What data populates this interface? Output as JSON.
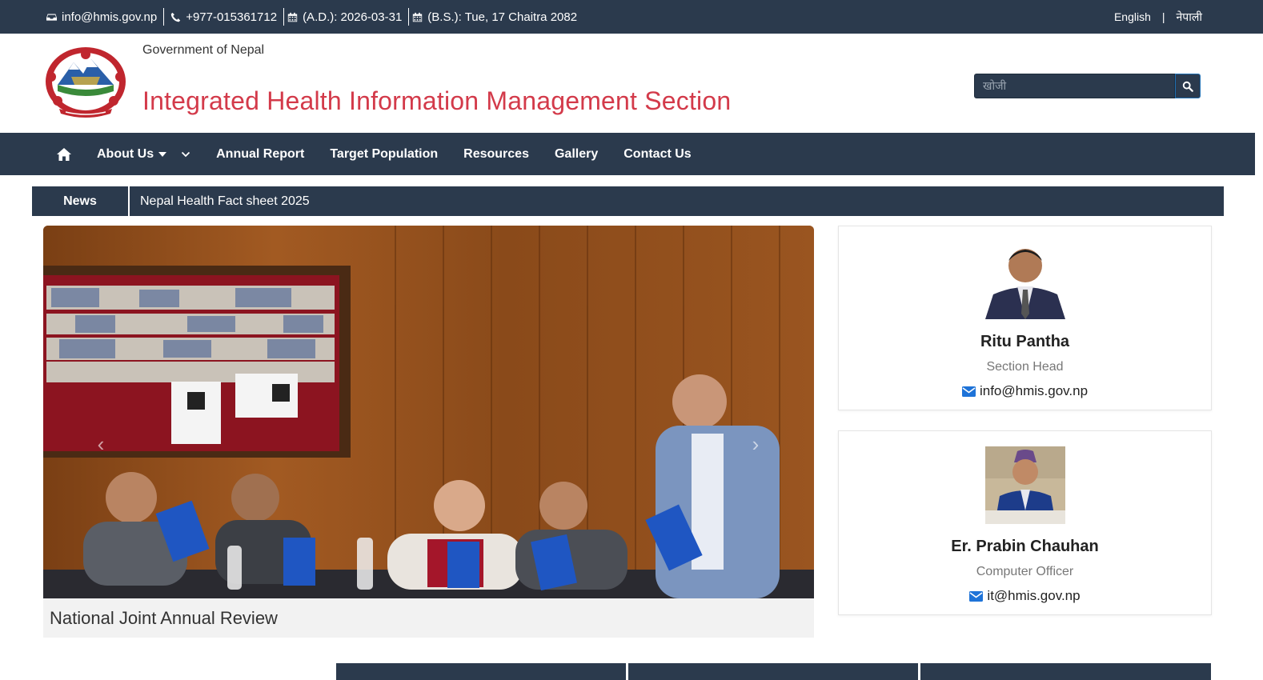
{
  "topbar": {
    "email": "info@hmis.gov.np",
    "phone": "+977-015361712",
    "date_ad": "(A.D.): 2026-03-31",
    "date_bs": "(B.S.): Tue, 17 Chaitra 2082",
    "lang_english": "English",
    "lang_separator": "|",
    "lang_nepali": "नेपाली"
  },
  "header": {
    "government": "Government of Nepal",
    "title": "Integrated Health Information Management Section",
    "search_placeholder": "खोजी"
  },
  "nav": {
    "items": [
      {
        "label": "About Us",
        "dropdown": true
      },
      {
        "label": "Annual Report"
      },
      {
        "label": "Target Population"
      },
      {
        "label": "Resources"
      },
      {
        "label": "Gallery"
      },
      {
        "label": "Contact Us"
      }
    ]
  },
  "news": {
    "label": "News",
    "headline": "Nepal Health Fact sheet 2025"
  },
  "carousel": {
    "caption": "National Joint Annual Review",
    "prev_symbol": "‹",
    "next_symbol": "›"
  },
  "profiles": [
    {
      "name": "Ritu Pantha",
      "role": "Section Head",
      "email": "info@hmis.gov.np"
    },
    {
      "name": "Er. Prabin Chauhan",
      "role": "Computer Officer",
      "email": "it@hmis.gov.np"
    }
  ],
  "colors": {
    "primary_dark": "#2b3a4d",
    "title_red": "#d33a4a",
    "mail_blue": "#1e73d8"
  }
}
